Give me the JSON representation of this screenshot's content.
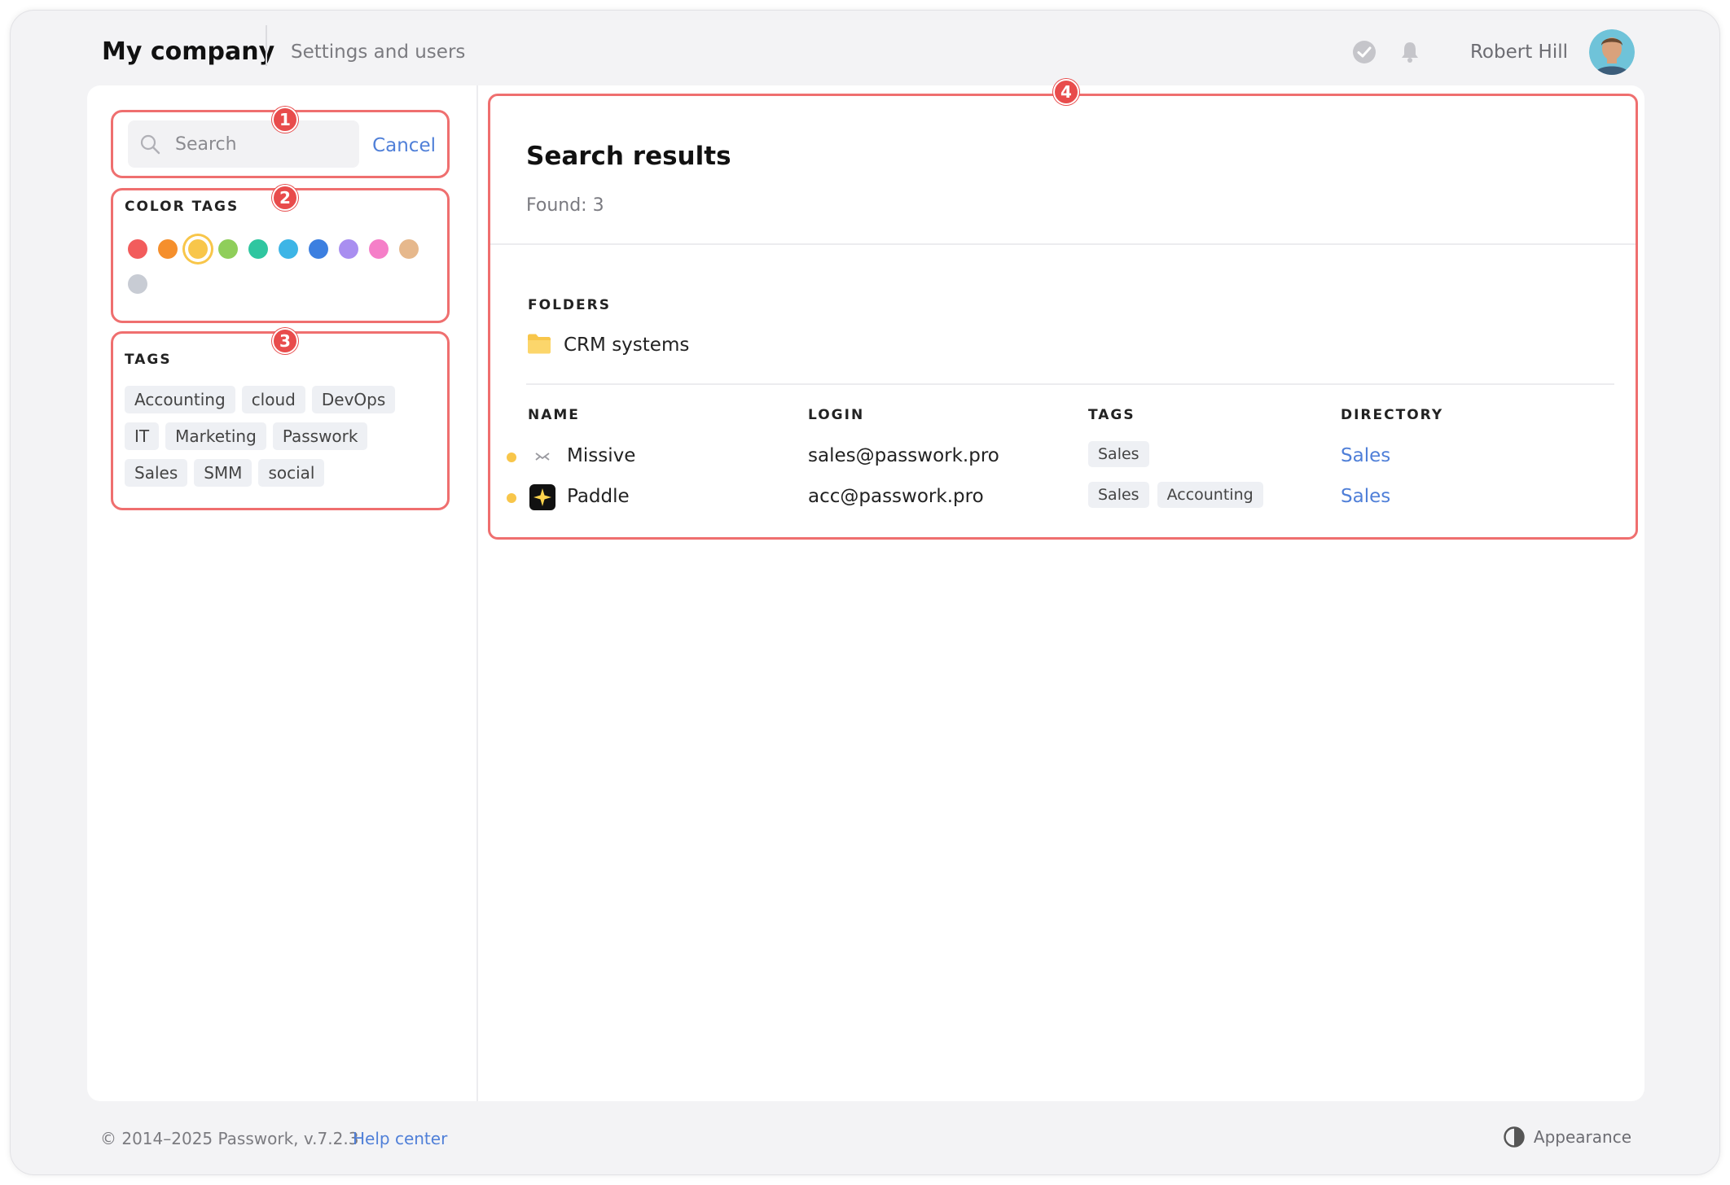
{
  "header": {
    "company": "My company",
    "settings_link": "Settings and users",
    "user_name": "Robert Hill"
  },
  "sidebar": {
    "search": {
      "placeholder": "Search",
      "value": "",
      "cancel_label": "Cancel"
    },
    "color_tags": {
      "label": "COLOR TAGS",
      "colors": [
        "#f25c5c",
        "#f58f2c",
        "#f8c64a",
        "#8fce5a",
        "#2fc6a0",
        "#3db5e6",
        "#3c7fe0",
        "#a98ef0",
        "#f57fc8",
        "#e6b88c",
        "#c8ccd4"
      ],
      "selected_index": 2
    },
    "tags": {
      "label": "TAGS",
      "items": [
        "Accounting",
        "cloud",
        "DevOps",
        "IT",
        "Marketing",
        "Passwork",
        "Sales",
        "SMM",
        "social"
      ]
    }
  },
  "callouts": [
    "1",
    "2",
    "3",
    "4"
  ],
  "results": {
    "title": "Search results",
    "found": "Found: 3",
    "folders_label": "FOLDERS",
    "folders": [
      {
        "name": "CRM systems"
      }
    ],
    "columns": [
      "NAME",
      "LOGIN",
      "TAGS",
      "DIRECTORY"
    ],
    "rows": [
      {
        "name": "Missive",
        "icon": "missive-logo-icon",
        "color": "#f8c64a",
        "login": "sales@passwork.pro",
        "tags": [
          "Sales"
        ],
        "directory": "Sales"
      },
      {
        "name": "Paddle",
        "icon": "paddle-logo-icon",
        "color": "#f8c64a",
        "login": "acc@passwork.pro",
        "tags": [
          "Sales",
          "Accounting"
        ],
        "directory": "Sales"
      }
    ]
  },
  "footer": {
    "copyright": "© 2014–2025 Passwork, v.7.2.3",
    "help": "Help center",
    "appearance": "Appearance"
  },
  "colors": {
    "accent": "#4f7fd8",
    "highlight": "#ef6f6f",
    "folder": "#f8c64a"
  }
}
